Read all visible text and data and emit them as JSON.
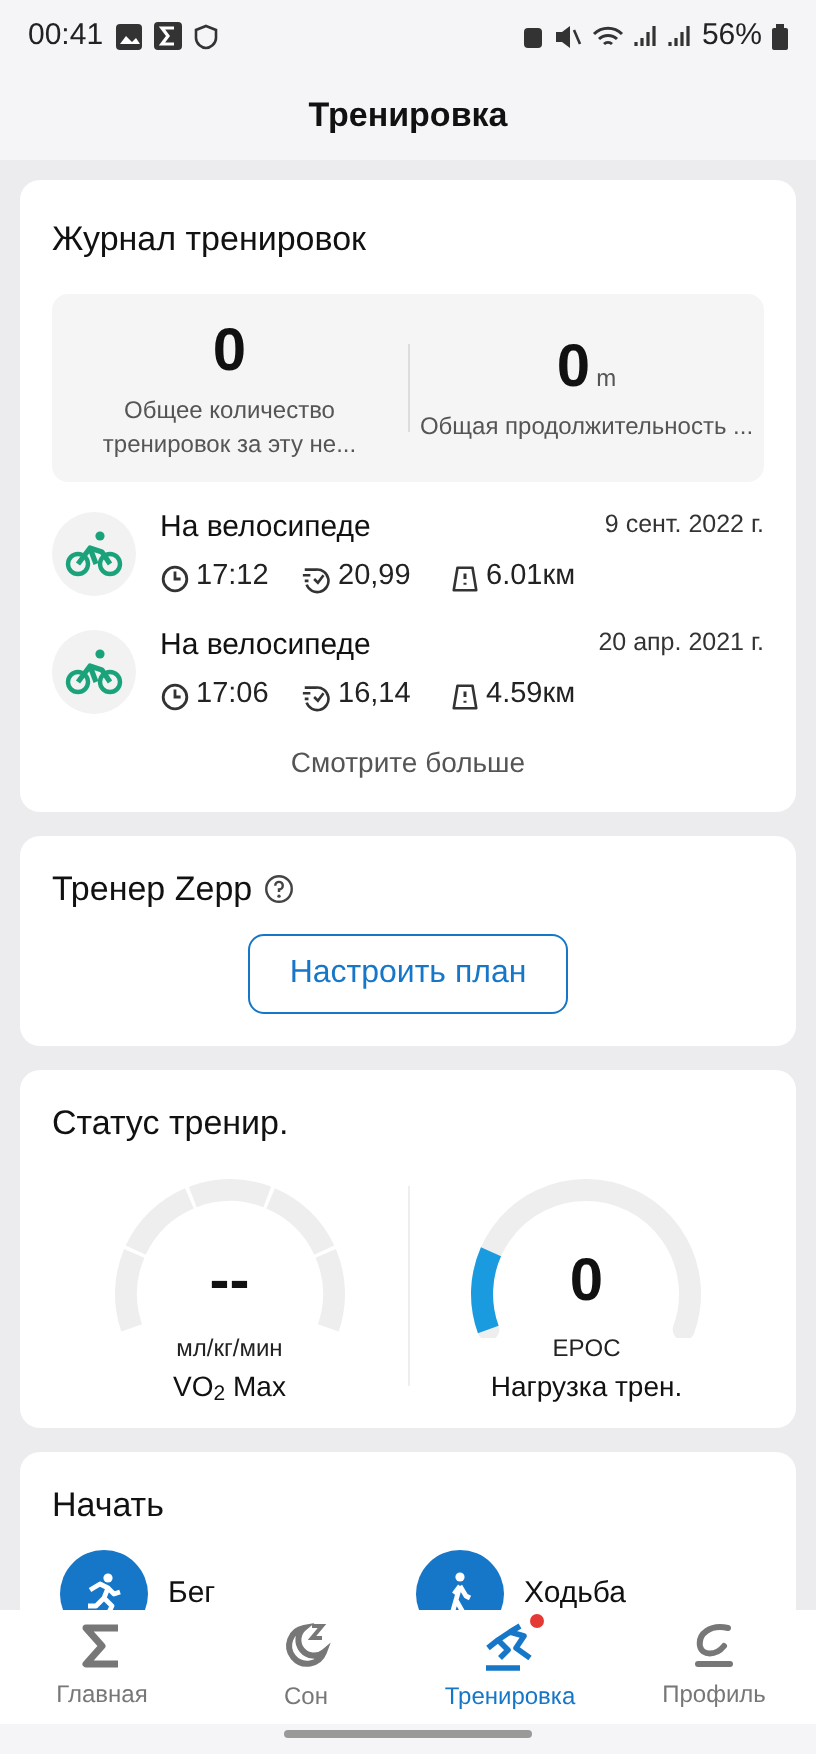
{
  "status_bar": {
    "time": "00:41",
    "battery": "56%"
  },
  "header": {
    "title": "Тренировка"
  },
  "journal": {
    "title": "Журнал тренировок",
    "stats": [
      {
        "value": "0",
        "label": "Общее количество тренировок за эту не..."
      },
      {
        "value": "0",
        "unit": "m",
        "label": "Общая продолжительность ..."
      }
    ],
    "workouts": [
      {
        "name": "На велосипеде",
        "date": "9 сент. 2022 г.",
        "time": "17:12",
        "pace": "20,99",
        "distance": "6.01км"
      },
      {
        "name": "На велосипеде",
        "date": "20 апр. 2021 г.",
        "time": "17:06",
        "pace": "16,14",
        "distance": "4.59км"
      }
    ],
    "more": "Смотрите больше"
  },
  "coach": {
    "title": "Тренер Zepp",
    "button": "Настроить план"
  },
  "status": {
    "title": "Статус тренир.",
    "gauges": [
      {
        "kind": "segmented",
        "value": "--",
        "unit": "мл/кг/мин",
        "label": "VO$_{2}$ Max"
      },
      {
        "kind": "fill",
        "value": "0",
        "unit": "EPOC",
        "label": "Нагрузка трен."
      }
    ]
  },
  "start": {
    "title": "Начать",
    "items": [
      {
        "kind": "run",
        "label": "Бег"
      },
      {
        "kind": "walk",
        "label": "Ходьба"
      }
    ]
  },
  "nav": [
    {
      "kind": "home",
      "label": "Главная",
      "selected": false,
      "dot": false
    },
    {
      "kind": "sleep",
      "label": "Сон",
      "selected": false,
      "dot": false
    },
    {
      "kind": "workout",
      "label": "Тренировка",
      "selected": true,
      "dot": true
    },
    {
      "kind": "profile",
      "label": "Профиль",
      "selected": false,
      "dot": false
    }
  ]
}
